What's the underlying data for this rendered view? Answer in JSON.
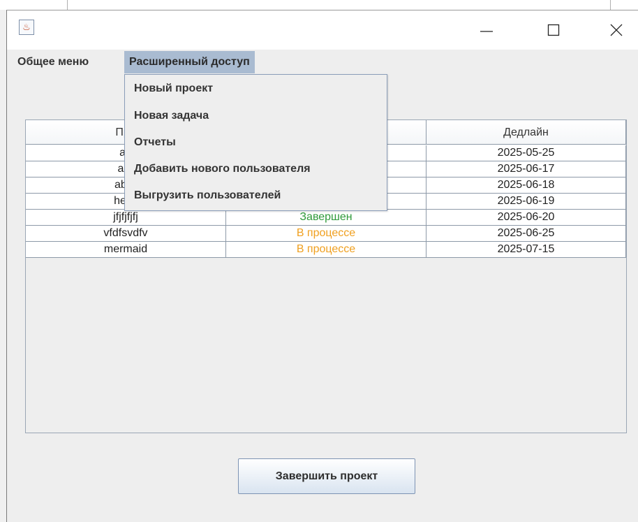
{
  "window": {
    "controls": {
      "minimize": "—",
      "maximize": "☐",
      "close": "×"
    }
  },
  "menubar": {
    "items": [
      {
        "label": "Общее меню"
      },
      {
        "label": "Расширенный доступ"
      }
    ]
  },
  "dropdown": {
    "items": [
      {
        "label": "Новый проект"
      },
      {
        "label": "Новая задача"
      },
      {
        "label": "Отчеты"
      },
      {
        "label": "Добавить нового пользователя"
      },
      {
        "label": "Выгрузить пользователей"
      }
    ]
  },
  "table": {
    "headers": [
      "Про",
      "",
      "Дедлайн"
    ],
    "rows": [
      {
        "name": "ab",
        "status": "",
        "deadline": "2025-05-25"
      },
      {
        "name": "abr",
        "status": "",
        "deadline": "2025-06-17"
      },
      {
        "name": "abra",
        "status": "",
        "deadline": "2025-06-18"
      },
      {
        "name": "hello",
        "status": "В процессе",
        "deadline": "2025-06-19"
      },
      {
        "name": "jfjfjfjfj",
        "status": "Завершен",
        "deadline": "2025-06-20"
      },
      {
        "name": "vfdfsvdfv",
        "status": "В процессе",
        "deadline": "2025-06-25"
      },
      {
        "name": "mermaid",
        "status": "В процессе",
        "deadline": "2025-07-15"
      }
    ]
  },
  "footer": {
    "finish_button": "Завершить проект"
  },
  "colors": {
    "menu_active_bg": "#a9bbd1",
    "status_in_progress": "#f0a020",
    "status_done": "#2f9a3a",
    "grid_line": "#8d99a8"
  }
}
